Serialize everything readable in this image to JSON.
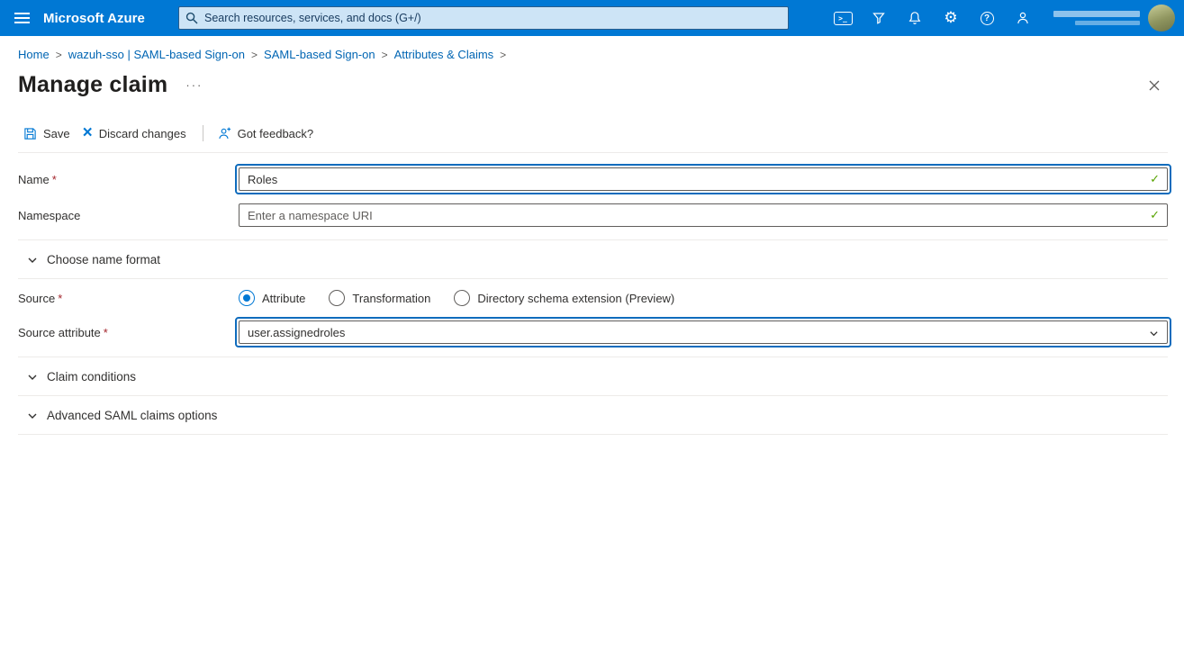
{
  "header": {
    "brand": "Microsoft Azure",
    "search_placeholder": "Search resources, services, and docs (G+/)",
    "icons": [
      "hamburger",
      "search",
      "cloud-shell",
      "directory-filter",
      "notifications",
      "settings",
      "help",
      "feedback"
    ]
  },
  "breadcrumb": {
    "separator": ">",
    "items": [
      {
        "label": "Home"
      },
      {
        "label": "wazuh-sso | SAML-based Sign-on"
      },
      {
        "label": "SAML-based Sign-on"
      },
      {
        "label": "Attributes & Claims"
      }
    ]
  },
  "page": {
    "title": "Manage claim",
    "more_options": "···"
  },
  "toolbar": {
    "save": "Save",
    "discard": "Discard changes",
    "feedback": "Got feedback?"
  },
  "form": {
    "required_mark": "*",
    "name": {
      "label": "Name",
      "value": "Roles"
    },
    "namespace": {
      "label": "Namespace",
      "placeholder": "Enter a namespace URI"
    },
    "choose_name_format": "Choose name format",
    "source": {
      "label": "Source",
      "options": [
        "Attribute",
        "Transformation",
        "Directory schema extension (Preview)"
      ],
      "selected": "Attribute"
    },
    "source_attribute": {
      "label": "Source attribute",
      "value": "user.assignedroles"
    },
    "claim_conditions": "Claim conditions",
    "advanced_saml_options": "Advanced SAML claims options"
  },
  "colors": {
    "header": "#0078d4",
    "accent": "#0078d4",
    "link": "#0065b3",
    "valid": "#57a300",
    "required": "#a4262c",
    "highlight": "#0f6cbd",
    "divider": "#edebe9"
  }
}
